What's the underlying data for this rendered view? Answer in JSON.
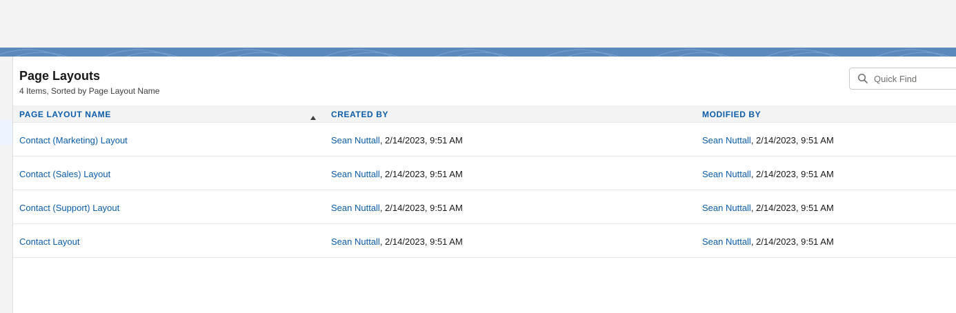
{
  "list": {
    "title": "Page Layouts",
    "subtitle": "4 Items, Sorted by Page Layout Name"
  },
  "search": {
    "placeholder": "Quick Find",
    "icon": "search-icon"
  },
  "table": {
    "columns": [
      {
        "label": "PAGE LAYOUT NAME",
        "sorted": "ascending"
      },
      {
        "label": "CREATED BY"
      },
      {
        "label": "MODIFIED BY"
      }
    ],
    "rows": [
      {
        "name": "Contact (Marketing) Layout",
        "created_user": "Sean Nuttall",
        "created_date": ", 2/14/2023, 9:51 AM",
        "modified_user": "Sean Nuttall",
        "modified_date": ", 2/14/2023, 9:51 AM"
      },
      {
        "name": "Contact (Sales) Layout",
        "created_user": "Sean Nuttall",
        "created_date": ", 2/14/2023, 9:51 AM",
        "modified_user": "Sean Nuttall",
        "modified_date": ", 2/14/2023, 9:51 AM"
      },
      {
        "name": "Contact (Support) Layout",
        "created_user": "Sean Nuttall",
        "created_date": ", 2/14/2023, 9:51 AM",
        "modified_user": "Sean Nuttall",
        "modified_date": ", 2/14/2023, 9:51 AM"
      },
      {
        "name": "Contact Layout",
        "created_user": "Sean Nuttall",
        "created_date": ", 2/14/2023, 9:51 AM",
        "modified_user": "Sean Nuttall",
        "modified_date": ", 2/14/2023, 9:51 AM"
      }
    ]
  },
  "colors": {
    "link": "#0b5cab",
    "band": "#5b88bd",
    "header_bg": "#f3f3f3"
  }
}
